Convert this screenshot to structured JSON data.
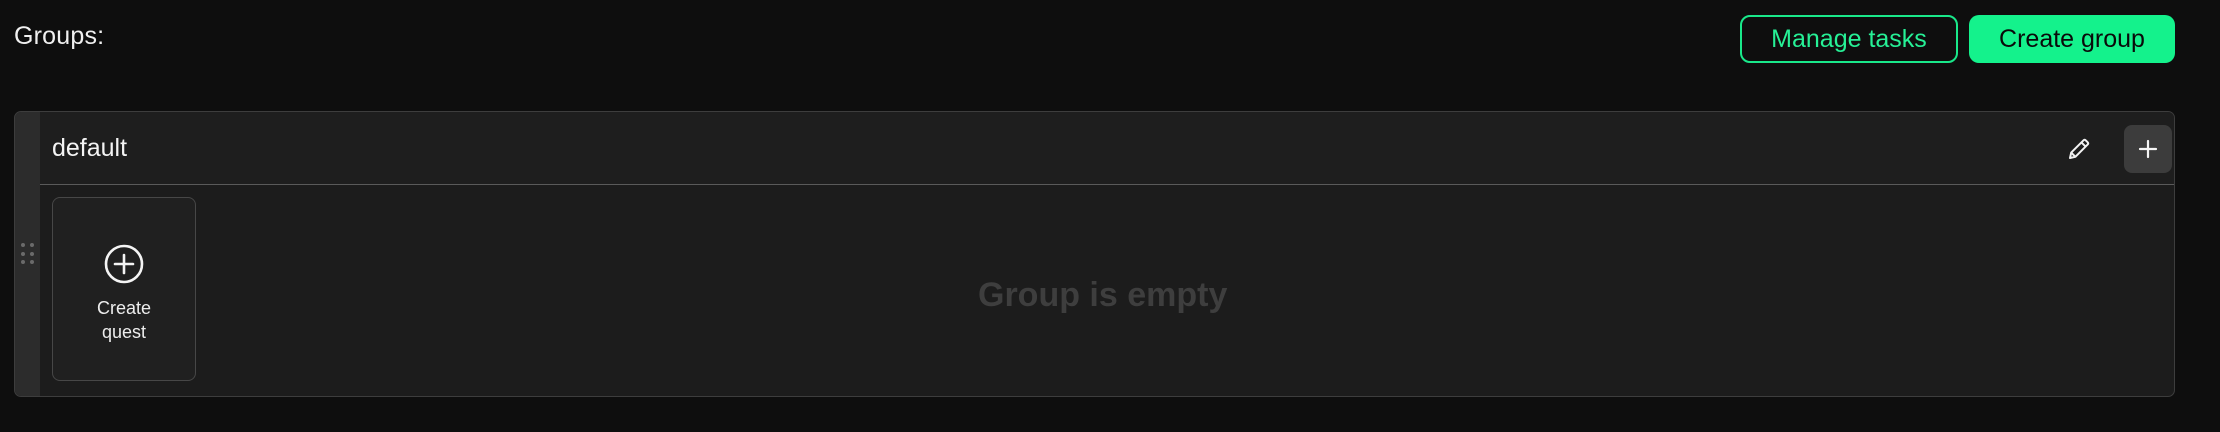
{
  "header": {
    "groups_label": "Groups:",
    "manage_tasks_label": "Manage tasks",
    "create_group_label": "Create group"
  },
  "group": {
    "name": "default",
    "edit_icon": "pencil-icon",
    "add_icon": "plus-icon",
    "drag_icon": "drag-handle-icon",
    "create_quest": {
      "icon": "plus-circle-icon",
      "label_line1": "Create",
      "label_line2": "quest"
    },
    "empty_message": "Group is empty"
  },
  "colors": {
    "accent": "#14f28c",
    "background": "#0e0e0e",
    "card": "#1c1c1c"
  }
}
